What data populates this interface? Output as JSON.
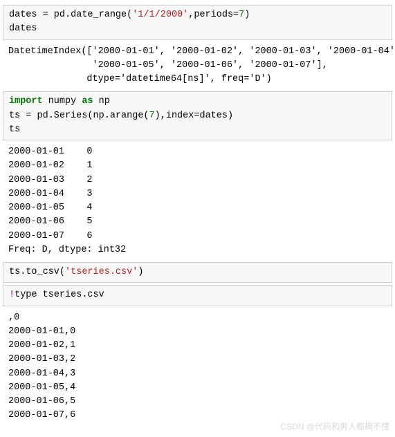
{
  "cell1": {
    "line1a": "dates = pd.date_range(",
    "str1": "'1/1/2000'",
    "line1b": ",periods=",
    "num1": "7",
    "line1c": ")",
    "line2": "dates"
  },
  "out1": "DatetimeIndex(['2000-01-01', '2000-01-02', '2000-01-03', '2000-01-04',\n               '2000-01-05', '2000-01-06', '2000-01-07'],\n              dtype='datetime64[ns]', freq='D')",
  "cell2": {
    "kw_import": "import",
    "mod": " numpy ",
    "kw_as": "as",
    "alias": " np",
    "l2a": "ts = pd.Series(np.arange(",
    "n7": "7",
    "l2b": "),index=dates)",
    "l3": "ts"
  },
  "out2": "2000-01-01    0\n2000-01-02    1\n2000-01-03    2\n2000-01-04    3\n2000-01-05    4\n2000-01-06    5\n2000-01-07    6\nFreq: D, dtype: int32",
  "cell3": {
    "a": "ts.to_csv(",
    "s": "'tseries.csv'",
    "b": ")"
  },
  "cell4": {
    "bang": "!",
    "cmd": "type tseries.csv"
  },
  "out4": ",0\n2000-01-01,0\n2000-01-02,1\n2000-01-03,2\n2000-01-04,3\n2000-01-05,4\n2000-01-06,5\n2000-01-07,6",
  "watermark": "CSDN @代码和男人都搞不懂"
}
